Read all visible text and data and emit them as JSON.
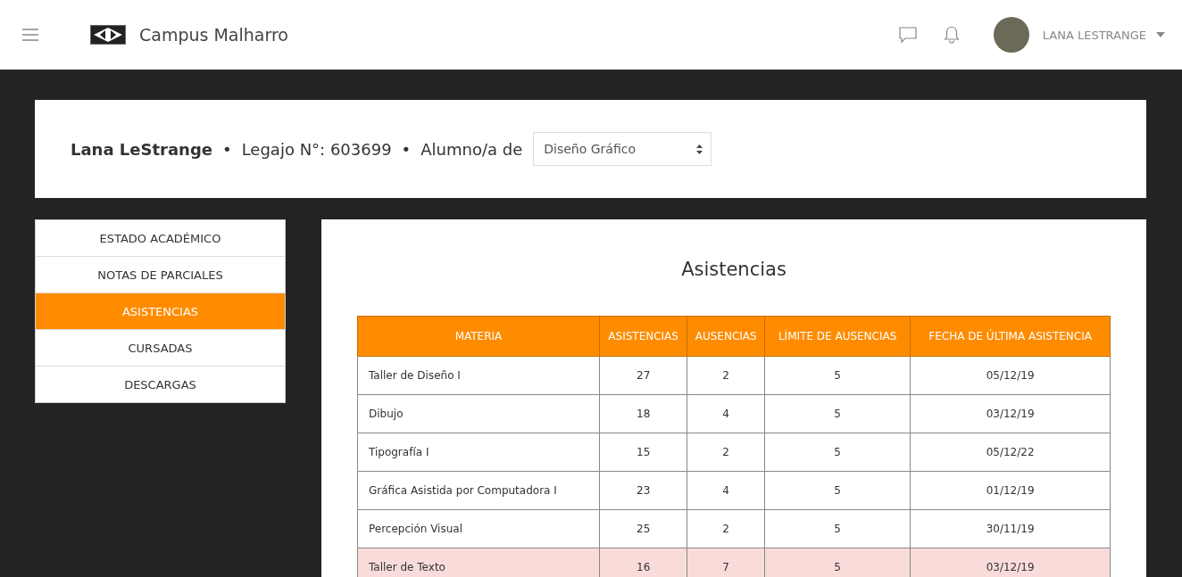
{
  "header": {
    "brand": "Campus Malharro",
    "user_name": "LANA LESTRANGE"
  },
  "student": {
    "name": "Lana LeStrange",
    "separator_1": "•",
    "legajo": "Legajo N°: 603699",
    "separator_2": "•",
    "alumno_label": "Alumno/a de",
    "career_select": "Diseño Gráfico"
  },
  "sidebar": {
    "items": [
      {
        "label": "ESTADO ACADÉMICO",
        "selected": false
      },
      {
        "label": "NOTAS DE PARCIALES",
        "selected": false
      },
      {
        "label": "ASISTENCIAS",
        "selected": true
      },
      {
        "label": "CURSADAS",
        "selected": false
      },
      {
        "label": "DESCARGAS",
        "selected": false
      }
    ]
  },
  "content": {
    "title": "Asistencias",
    "table": {
      "columns": [
        "MATERIA",
        "ASISTENCIAS",
        "AUSENCIAS",
        "LÍMITE DE AUSENCIAS",
        "FECHA DE ÚLTIMA ASISTENCIA"
      ],
      "rows": [
        {
          "cells": [
            "Taller de Diseño I",
            "27",
            "2",
            "5",
            "05/12/19"
          ],
          "over_limit": false
        },
        {
          "cells": [
            "Dibujo",
            "18",
            "4",
            "5",
            "03/12/19"
          ],
          "over_limit": false
        },
        {
          "cells": [
            "Tipografía I",
            "15",
            "2",
            "5",
            "05/12/22"
          ],
          "over_limit": false
        },
        {
          "cells": [
            "Gráfica Asistida por Computadora I",
            "23",
            "4",
            "5",
            "01/12/19"
          ],
          "over_limit": false
        },
        {
          "cells": [
            "Percepción Visual",
            "25",
            "2",
            "5",
            "30/11/19"
          ],
          "over_limit": false
        },
        {
          "cells": [
            "Taller de Texto",
            "16",
            "7",
            "5",
            "03/12/19"
          ],
          "over_limit": true
        }
      ]
    }
  }
}
